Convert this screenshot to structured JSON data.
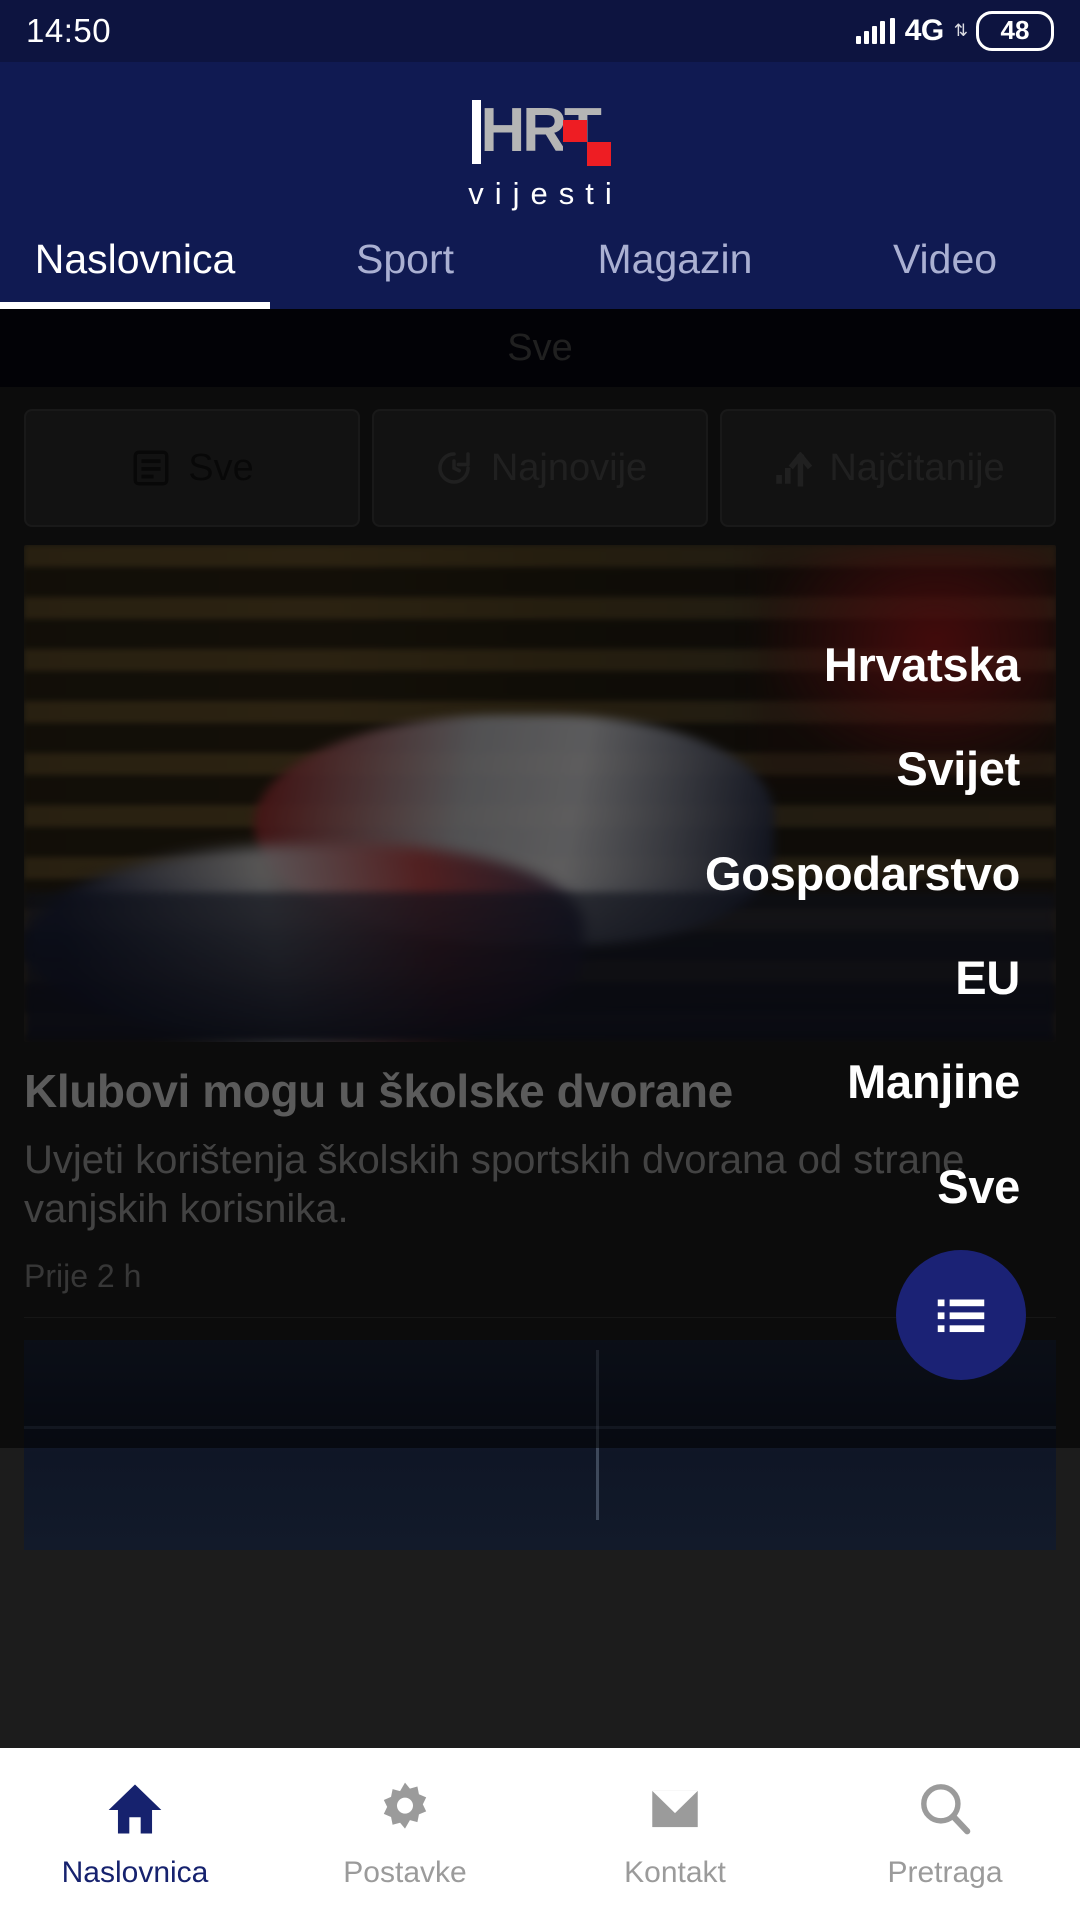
{
  "status_bar": {
    "time": "14:50",
    "network_type": "4G",
    "battery_level": "48",
    "signal_icon": "signal-bars-icon",
    "data_arrows_icon": "data-transfer-icon"
  },
  "header": {
    "logo_text": "HRT",
    "logo_subtitle": "vijesti",
    "brand_navy": "#101a52",
    "brand_red": "#ee1d23",
    "logo_gray": "#b5b5b5",
    "tabs": [
      {
        "label": "Naslovnica",
        "active": true
      },
      {
        "label": "Sport",
        "active": false
      },
      {
        "label": "Magazin",
        "active": false
      },
      {
        "label": "Video",
        "active": false
      }
    ]
  },
  "section_header": {
    "title": "Sve"
  },
  "filter_chips": [
    {
      "label": "Sve",
      "icon": "article-list-icon",
      "selected": true
    },
    {
      "label": "Najnovije",
      "icon": "refresh-clock-icon",
      "selected": false
    },
    {
      "label": "Najčitanije",
      "icon": "trending-up-icon",
      "selected": false
    }
  ],
  "articles": [
    {
      "title": "Klubovi mogu u školske dvorane",
      "summary": "Uvjeti korištenja školskih sportskih dvorana od strane vanjskih korisnika.",
      "time": "Prije 2 h",
      "image": "handball-players-gym-photo"
    },
    {
      "image": "sea-horizon-photo"
    }
  ],
  "overlay_menu": {
    "items": [
      {
        "label": "Hrvatska"
      },
      {
        "label": "Svijet"
      },
      {
        "label": "Gospodarstvo"
      },
      {
        "label": "EU"
      },
      {
        "label": "Manjine"
      },
      {
        "label": "Sve"
      }
    ]
  },
  "fab": {
    "icon": "list-menu-icon",
    "color": "#1b2275"
  },
  "bottom_nav": {
    "items": [
      {
        "label": "Naslovnica",
        "icon": "home-icon",
        "active": true
      },
      {
        "label": "Postavke",
        "icon": "gear-icon",
        "active": false
      },
      {
        "label": "Kontakt",
        "icon": "envelope-icon",
        "active": false
      },
      {
        "label": "Pretraga",
        "icon": "search-icon",
        "active": false
      }
    ]
  }
}
